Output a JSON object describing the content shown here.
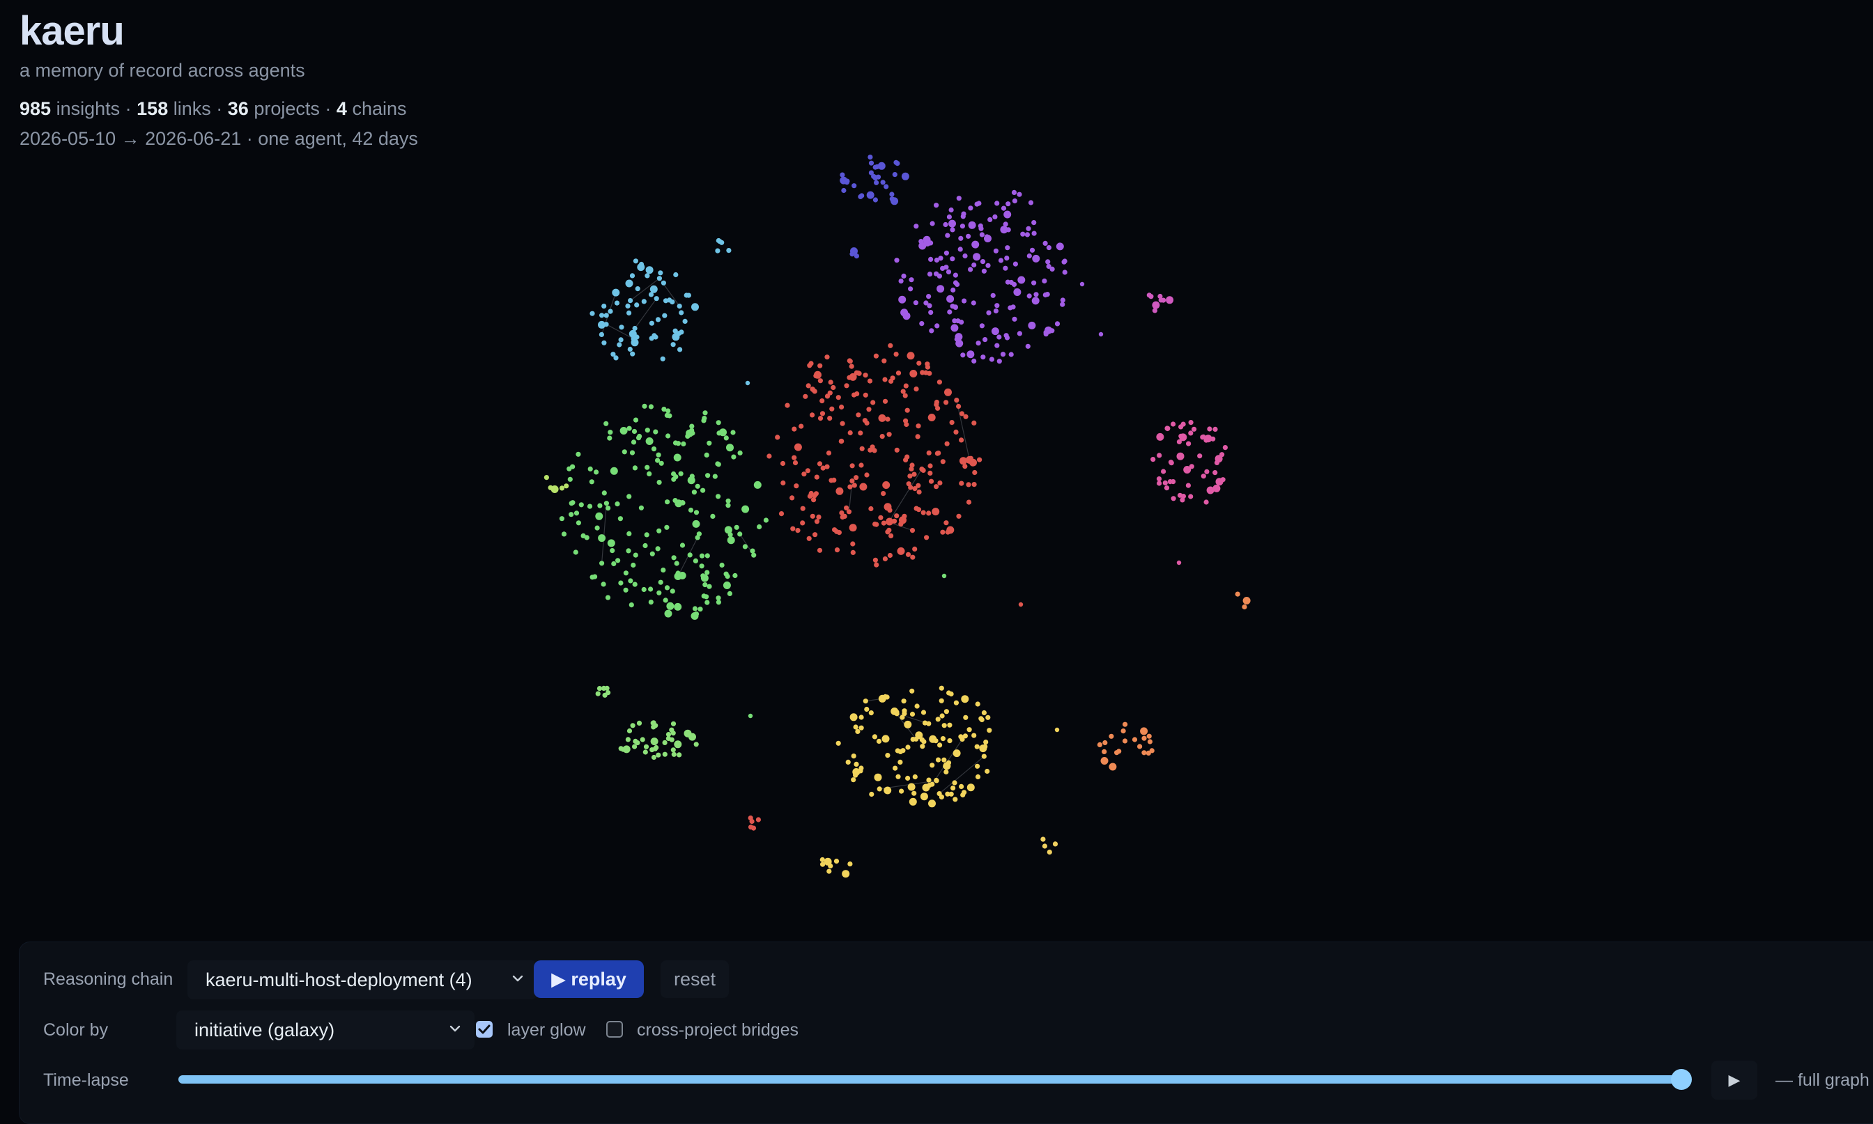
{
  "header": {
    "title": "kaeru",
    "subtitle": "a memory of record across agents",
    "stats": {
      "insights_count": "985",
      "insights_label": "insights",
      "links_count": "158",
      "links_label": "links",
      "projects_count": "36",
      "projects_label": "projects",
      "chains_count": "4",
      "chains_label": "chains",
      "separator": "·"
    },
    "range": "2026-05-10 → 2026-06-21 · one agent, 42 days"
  },
  "controls": {
    "reasoning_chain": {
      "label": "Reasoning chain",
      "selected": "kaeru-multi-host-deployment (4)",
      "replay_label": "▶ replay",
      "reset_label": "reset"
    },
    "color_by": {
      "label": "Color by",
      "selected": "initiative (galaxy)",
      "layer_glow": {
        "label": "layer glow",
        "checked": true
      },
      "cross_project_bridges": {
        "label": "cross-project bridges",
        "checked": false
      }
    },
    "timelapse": {
      "label": "Time-lapse",
      "progress": 1.0,
      "play_glyph": "▶",
      "status": "— full graph"
    }
  },
  "graph": {
    "clusters": [
      {
        "color": "#e0574f",
        "count": 230
      },
      {
        "color": "#77dd77",
        "count": 190
      },
      {
        "color": "#a35de6",
        "count": 165
      },
      {
        "color": "#f2d45c",
        "count": 125
      },
      {
        "color": "#6fc3e6",
        "count": 65
      },
      {
        "color": "#e05aa6",
        "count": 55
      },
      {
        "color": "#5a56d6",
        "count": 30
      },
      {
        "color": "#8ee07a",
        "count": 38
      },
      {
        "color": "#ef8a55",
        "count": 20
      },
      {
        "color": "#f2d45c",
        "count": 8
      },
      {
        "color": "#6fc3e6",
        "count": 5
      },
      {
        "color": "#d05ac0",
        "count": 8
      },
      {
        "color": "#f0d060",
        "count": 4
      },
      {
        "color": "#8ee07a",
        "count": 6
      },
      {
        "color": "#e0574f",
        "count": 5
      },
      {
        "color": "#b8e26a",
        "count": 5
      },
      {
        "color": "#5a56d6",
        "count": 3
      },
      {
        "color": "#ef8a55",
        "count": 3
      }
    ],
    "stray_points": [
      {
        "color": "#a35de6"
      },
      {
        "color": "#e0574f"
      },
      {
        "color": "#77dd77"
      },
      {
        "color": "#f2d45c"
      },
      {
        "color": "#e05aa6"
      },
      {
        "color": "#6fc3e6"
      },
      {
        "color": "#77dd77"
      },
      {
        "color": "#a35de6"
      }
    ],
    "link_color": "#8a8f98"
  }
}
